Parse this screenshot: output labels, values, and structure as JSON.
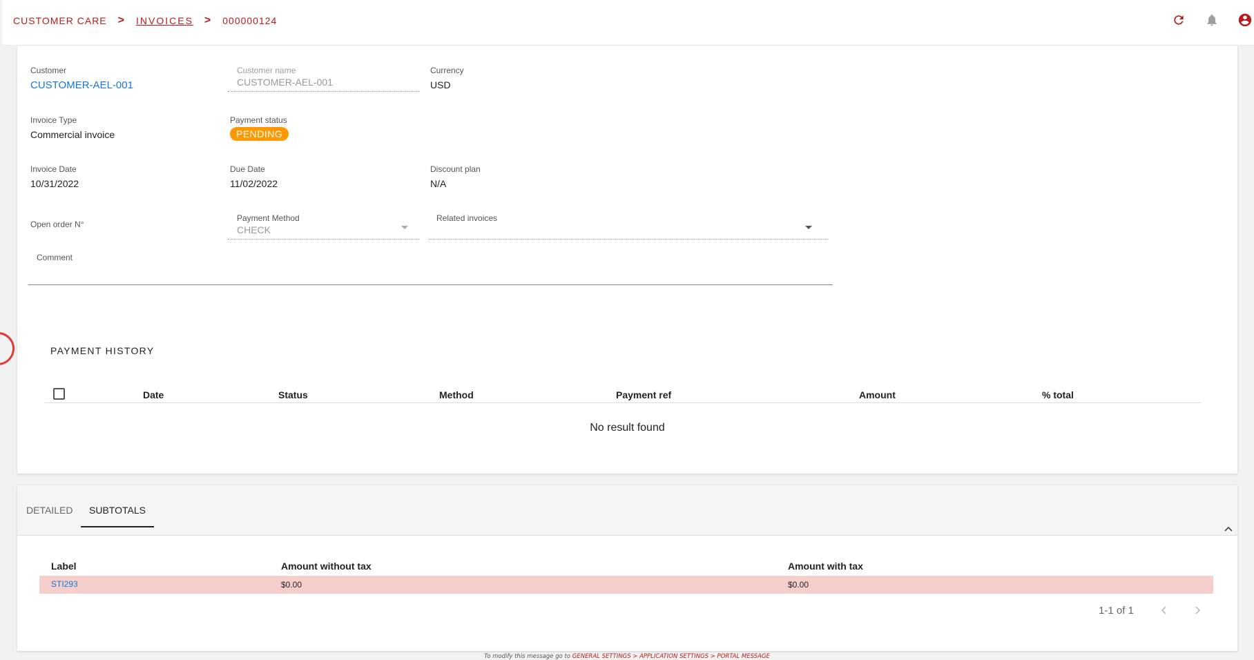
{
  "breadcrumb": {
    "items": [
      {
        "label": "CUSTOMER CARE"
      },
      {
        "label": "INVOICES"
      },
      {
        "label": "000000124"
      }
    ],
    "separator": ">"
  },
  "header_icons": [
    "refresh-icon",
    "bell-icon",
    "account-icon"
  ],
  "fields": {
    "customer": {
      "label": "Customer",
      "value": "CUSTOMER-AEL-001"
    },
    "customer_name": {
      "label": "Customer name",
      "value": "CUSTOMER-AEL-001"
    },
    "currency": {
      "label": "Currency",
      "value": "USD"
    },
    "invoice_type": {
      "label": "Invoice Type",
      "value": "Commercial invoice"
    },
    "payment_status": {
      "label": "Payment status",
      "value": "PENDING",
      "color": "#ff9800"
    },
    "invoice_date": {
      "label": "Invoice Date",
      "value": "10/31/2022"
    },
    "due_date": {
      "label": "Due Date",
      "value": "11/02/2022"
    },
    "discount_plan": {
      "label": "Discount plan",
      "value": "N/A"
    },
    "open_order": {
      "label": "Open order N°"
    },
    "payment_method": {
      "label": "Payment Method",
      "value": "CHECK"
    },
    "related_invoices": {
      "label": "Related invoices",
      "value": ""
    },
    "comment": {
      "label": "Comment",
      "value": ""
    }
  },
  "payment_history": {
    "title": "PAYMENT HISTORY",
    "columns": [
      "Date",
      "Status",
      "Method",
      "Payment ref",
      "Amount",
      "% total"
    ],
    "empty_text": "No result found"
  },
  "tabs": [
    {
      "label": "DETAILED",
      "active": false
    },
    {
      "label": "SUBTOTALS",
      "active": true
    }
  ],
  "subtotals": {
    "columns": [
      "Label",
      "Amount without tax",
      "Amount with tax"
    ],
    "rows": [
      {
        "label": "STI293",
        "amount_without_tax": "$0.00",
        "amount_with_tax": "$0.00"
      }
    ],
    "pagination": "1-1 of 1"
  },
  "footer": {
    "prefix": "To modify this message go to",
    "path": "GENERAL SETTINGS > APPLICATION SETTINGS > PORTAL MESSAGE"
  },
  "colors": {
    "brand": "#b71c1c",
    "link": "#1976d2",
    "pending": "#ff9800",
    "row_highlight": "#f4cfcc"
  }
}
